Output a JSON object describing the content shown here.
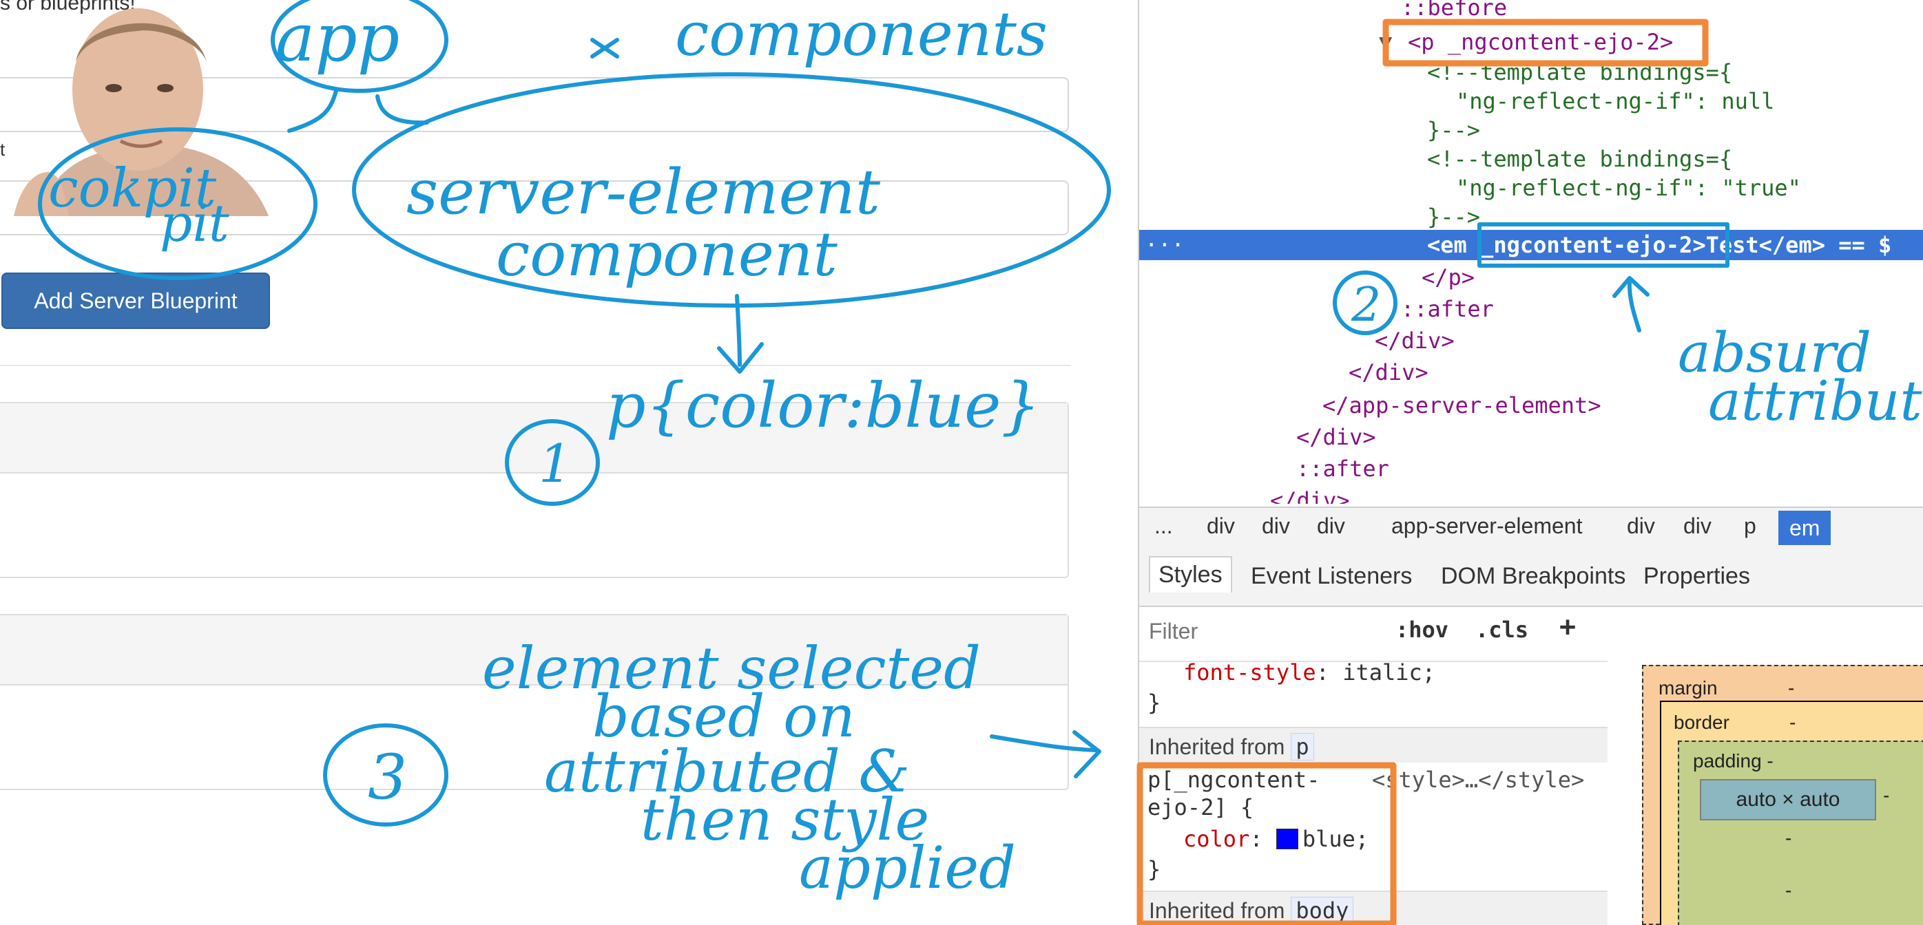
{
  "app": {
    "intro_text": "s or blueprints!",
    "label_fragment": "t",
    "add_blueprint_label": "Add Server Blueprint"
  },
  "devtools": {
    "dom_lines": {
      "before": "::before",
      "p_open": "<p _ngcontent-ejo-2>",
      "comment1_a": "<!--template bindings={",
      "comment1_b": "\"ng-reflect-ng-if\": null",
      "comment1_c": "}-->",
      "comment2_a": "<!--template bindings={",
      "comment2_b": "\"ng-reflect-ng-if\": \"true\"",
      "comment2_c": "}-->",
      "selected_ellipsis": "···",
      "selected_line": "<em _ngcontent-ejo-2>Test</em> == $",
      "p_close": "</p>",
      "after1": "::after",
      "div_close1": "</div>",
      "div_close2": "</div>",
      "app_server_close": "</app-server-element>",
      "div_close3": "</div>",
      "after2": "::after",
      "div_close4": "</div>"
    },
    "breadcrumbs": [
      "...",
      "div",
      "div",
      "div",
      "app-server-element",
      "div",
      "div",
      "p",
      "em"
    ],
    "tabs": [
      "Styles",
      "Event Listeners",
      "DOM Breakpoints",
      "Properties"
    ],
    "filter": {
      "placeholder": "Filter",
      "hov": ":hov",
      "cls": ".cls",
      "plus": "+"
    },
    "styles": {
      "prop1_name": "font-style",
      "prop1_value": "italic;",
      "rule_close": "}",
      "inherited_p_label": "Inherited from",
      "inherited_p_chip": "p",
      "rule_selector_a": "p[_ngcontent-",
      "rule_selector_b": "ejo-2] {",
      "rule_source": "<style>…</style>",
      "rule_prop_name": "color",
      "rule_prop_value": "blue;",
      "rule_close2": "}",
      "inherited_body_label": "Inherited from",
      "inherited_body_chip": "body"
    },
    "box_model": {
      "margin_label": "margin",
      "margin_value": "-",
      "border_label": "border",
      "border_value": "-",
      "padding_label": "padding -",
      "content_label": "auto × auto",
      "dash": "-"
    }
  },
  "annotations": {
    "app": "app",
    "components": "components",
    "cockpit_1": "cokpit",
    "cockpit_2": "pit",
    "server_element_1": "server-element",
    "server_element_2": "component",
    "css_rule": "p{color:blue}",
    "num1": "1",
    "num2": "2",
    "num3": "3",
    "absurd_1": "absurd",
    "absurd_2": "attribute",
    "note_1": "element selected",
    "note_2": "based on",
    "note_3": "attributed &",
    "note_4": "then style",
    "note_5": "applied"
  },
  "colors": {
    "annotation_ink": "#1a97d6",
    "highlight_orange": "#f0883a",
    "devtools_selection": "#3875d7",
    "button_primary": "#3a70b0"
  }
}
